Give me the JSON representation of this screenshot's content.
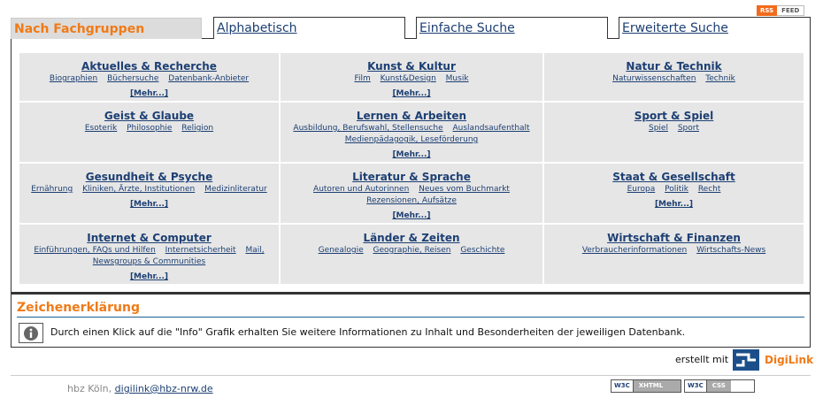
{
  "rss": {
    "left": "RSS",
    "right": "FEED"
  },
  "tabs": {
    "active": "Nach Fachgruppen",
    "t1": "Alphabetisch",
    "t2": "Einfache Suche",
    "t3": "Erweiterte Suche"
  },
  "groups": [
    {
      "title": "Aktuelles & Recherche",
      "subs": [
        "Biographien",
        "Büchersuche",
        "Datenbank-Anbieter"
      ],
      "more": "[Mehr...]"
    },
    {
      "title": "Kunst & Kultur",
      "subs": [
        "Film",
        "Kunst&Design",
        "Musik"
      ],
      "more": "[Mehr...]"
    },
    {
      "title": "Natur & Technik",
      "subs": [
        "Naturwissenschaften",
        "Technik"
      ],
      "more": ""
    },
    {
      "title": "Geist & Glaube",
      "subs": [
        "Esoterik",
        "Philosophie",
        "Religion"
      ],
      "more": ""
    },
    {
      "title": "Lernen & Arbeiten",
      "subs": [
        "Ausbildung, Berufswahl, Stellensuche",
        "Auslandsaufenthalt",
        "Medienpädagogik, Leseförderung"
      ],
      "more": "[Mehr...]"
    },
    {
      "title": "Sport & Spiel",
      "subs": [
        "Spiel",
        "Sport"
      ],
      "more": ""
    },
    {
      "title": "Gesundheit & Psyche",
      "subs": [
        "Ernährung",
        "Kliniken, Ärzte, Institutionen",
        "Medizinliteratur"
      ],
      "more": "[Mehr...]"
    },
    {
      "title": "Literatur & Sprache",
      "subs": [
        "Autoren und Autorinnen",
        "Neues vom Buchmarkt",
        "Rezensionen, Aufsätze"
      ],
      "more": "[Mehr...]"
    },
    {
      "title": "Staat & Gesellschaft",
      "subs": [
        "Europa",
        "Politik",
        "Recht"
      ],
      "more": "[Mehr...]"
    },
    {
      "title": "Internet & Computer",
      "subs": [
        "Einführungen, FAQs und Hilfen",
        "Internetsicherheit",
        "Mail,",
        "Newsgroups & Communities"
      ],
      "more": "[Mehr...]"
    },
    {
      "title": "Länder & Zeiten",
      "subs": [
        "Genealogie",
        "Geographie, Reisen",
        "Geschichte"
      ],
      "more": ""
    },
    {
      "title": "Wirtschaft & Finanzen",
      "subs": [
        "Verbraucherinformationen",
        "Wirtschafts-News"
      ],
      "more": ""
    }
  ],
  "legend": {
    "title": "Zeichenerklärung",
    "text": "Durch einen Klick auf die \"Info\" Grafik erhalten Sie weitere Informationen zu Inhalt und Besonderheiten der jeweiligen Datenbank."
  },
  "footer": {
    "made_by": "erstellt mit",
    "brand": "DigiLink",
    "address_prefix": "hbz Köln,",
    "email": "digilink@hbz-nrw.de",
    "badge_w3c": "W3C",
    "badge_xhtml": "XHTML 1.0",
    "badge_css": "CSS"
  }
}
